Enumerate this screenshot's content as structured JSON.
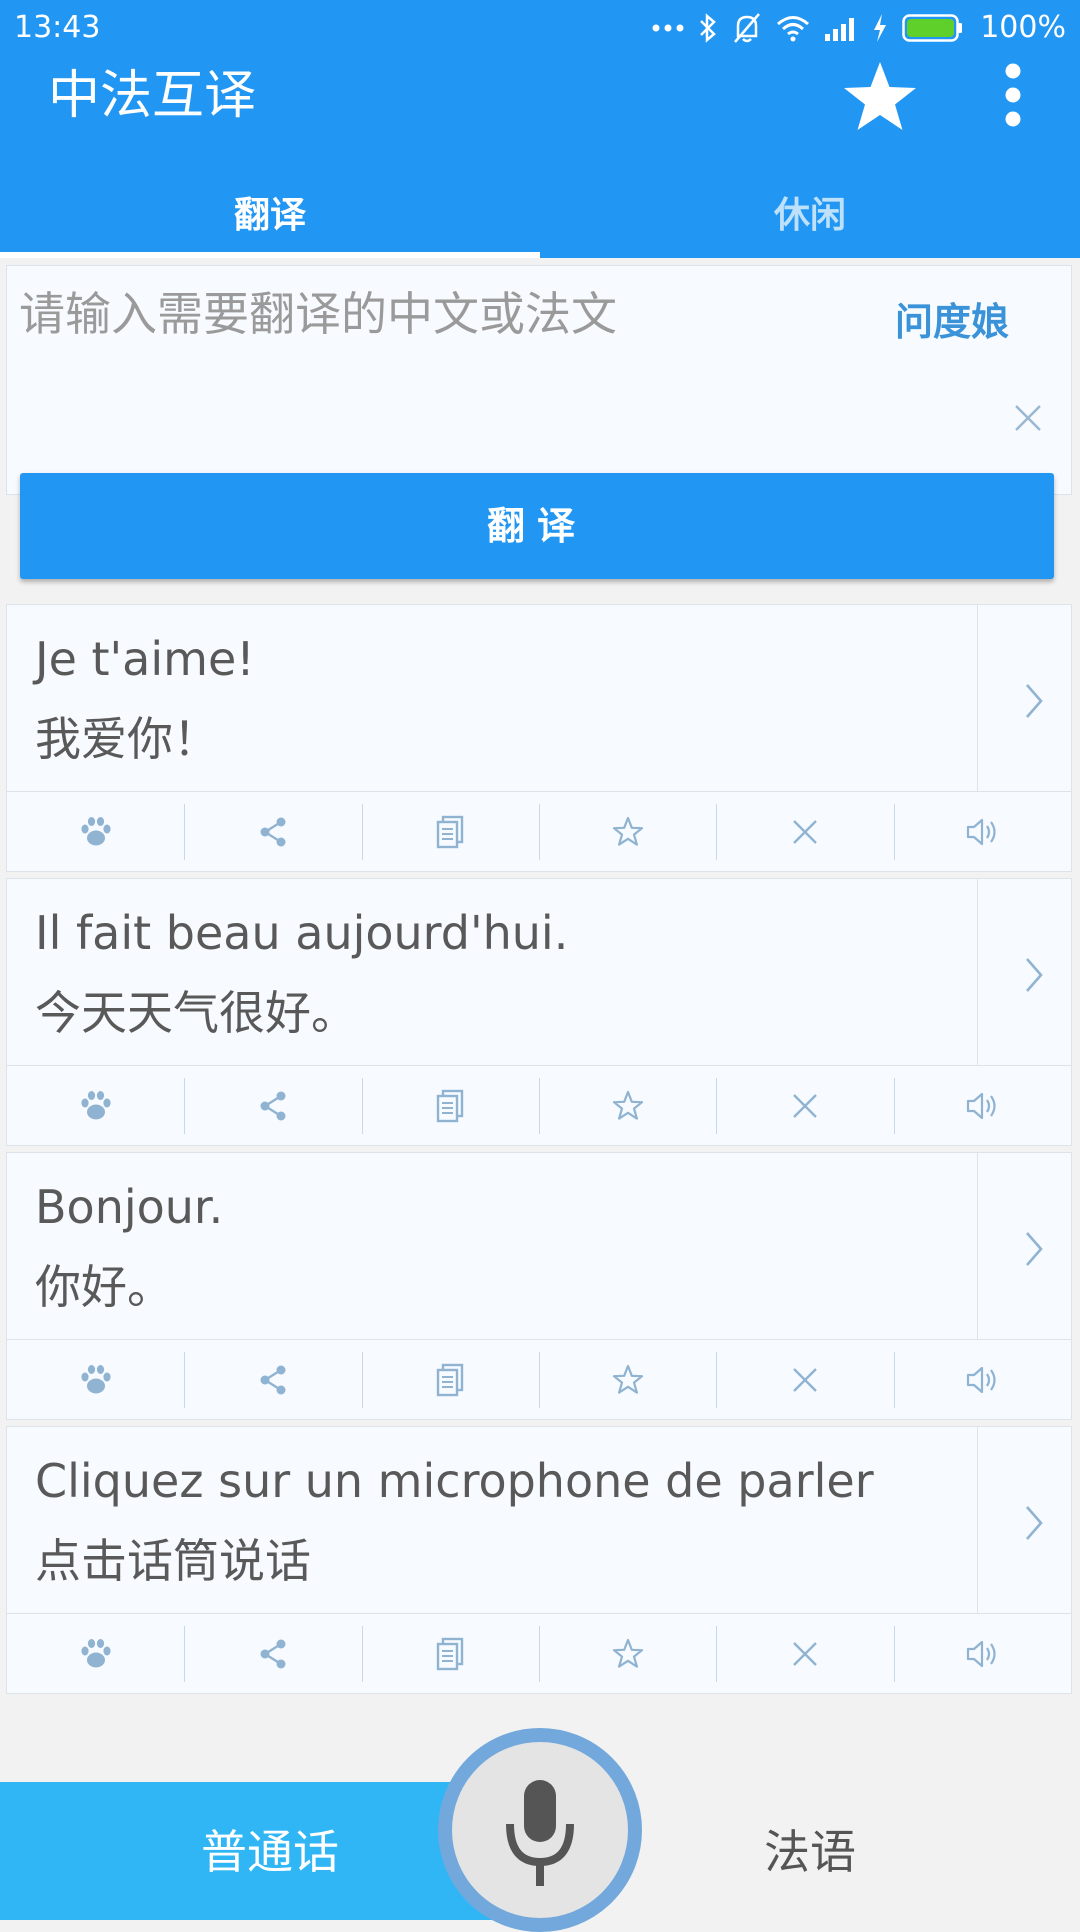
{
  "status_bar": {
    "time": "13:43",
    "battery": "100%",
    "icons": [
      "more-dots-icon",
      "bluetooth-icon",
      "silent-bell-icon",
      "wifi-icon",
      "signal-icon",
      "charging-icon",
      "battery-icon"
    ],
    "battery_color": "#5fcf2a"
  },
  "app": {
    "title": "中法互译",
    "actions": [
      "star-icon",
      "more-vert-icon"
    ],
    "accent_color": "#2196f3"
  },
  "tabs": [
    {
      "label": "翻译",
      "active": true
    },
    {
      "label": "休闲",
      "active": false
    }
  ],
  "input": {
    "placeholder": "请输入需要翻译的中文或法文",
    "value": "",
    "ask_link": "问度娘",
    "translate_button": "翻译"
  },
  "phrases": [
    {
      "fr": "Je t'aime!",
      "zh": "我爱你！"
    },
    {
      "fr": "Il fait beau aujourd'hui.",
      "zh": "今天天气很好。"
    },
    {
      "fr": "Bonjour.",
      "zh": "你好。"
    },
    {
      "fr": "Cliquez sur un microphone de parler",
      "zh": "点击话筒说话"
    }
  ],
  "phrase_actions": [
    "paw-icon",
    "share-icon",
    "copy-icon",
    "star-outline-icon",
    "delete-x-icon",
    "speaker-icon"
  ],
  "bottom": {
    "left_lang": "普通话",
    "right_lang": "法语",
    "mic": "microphone-icon"
  }
}
